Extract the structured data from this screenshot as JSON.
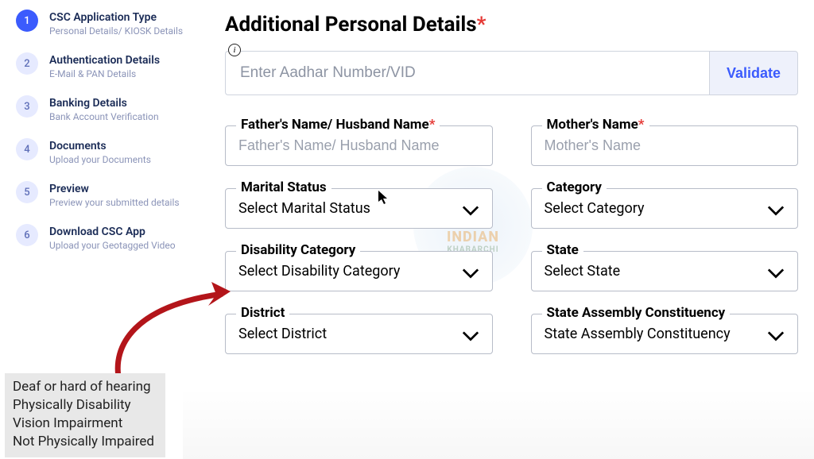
{
  "sidebar": {
    "steps": [
      {
        "num": "1",
        "title": "CSC Application Type",
        "sub": "Personal Details/ KIOSK Details",
        "active": true
      },
      {
        "num": "2",
        "title": "Authentication Details",
        "sub": "E-Mail & PAN Details",
        "active": false
      },
      {
        "num": "3",
        "title": "Banking Details",
        "sub": "Bank Account Verification",
        "active": false
      },
      {
        "num": "4",
        "title": "Documents",
        "sub": "Upload your Documents",
        "active": false
      },
      {
        "num": "5",
        "title": "Preview",
        "sub": "Preview your submitted details",
        "active": false
      },
      {
        "num": "6",
        "title": "Download CSC App",
        "sub": "Upload your Geotagged Video",
        "active": false
      }
    ]
  },
  "main": {
    "title": "Additional Personal Details",
    "aadhar_placeholder": "Enter Aadhar Number/VID",
    "validate_label": "Validate",
    "fields": {
      "father": {
        "label": "Father's Name/ Husband Name",
        "placeholder": "Father's Name/ Husband Name",
        "required": true
      },
      "mother": {
        "label": "Mother's Name",
        "placeholder": "Mother's Name",
        "required": true
      },
      "marital": {
        "label": "Marital Status",
        "value": "Select Marital Status"
      },
      "category": {
        "label": "Category",
        "value": "Select Category"
      },
      "disability": {
        "label": "Disability Category",
        "value": "Select Disability Category"
      },
      "state": {
        "label": "State",
        "value": "Select State"
      },
      "district": {
        "label": "District",
        "value": "Select District"
      },
      "sac": {
        "label": "State Assembly Constituency",
        "value": "State Assembly Constituency"
      }
    }
  },
  "disability_options": [
    "Deaf or hard of hearing",
    "Physically Disability",
    "Vision Impairment",
    "Not Physically Impaired"
  ],
  "watermark": {
    "line1": "INDIAN",
    "line2": "KHABARCHI"
  },
  "colors": {
    "accent": "#3b5bfd",
    "required": "#e53935"
  }
}
